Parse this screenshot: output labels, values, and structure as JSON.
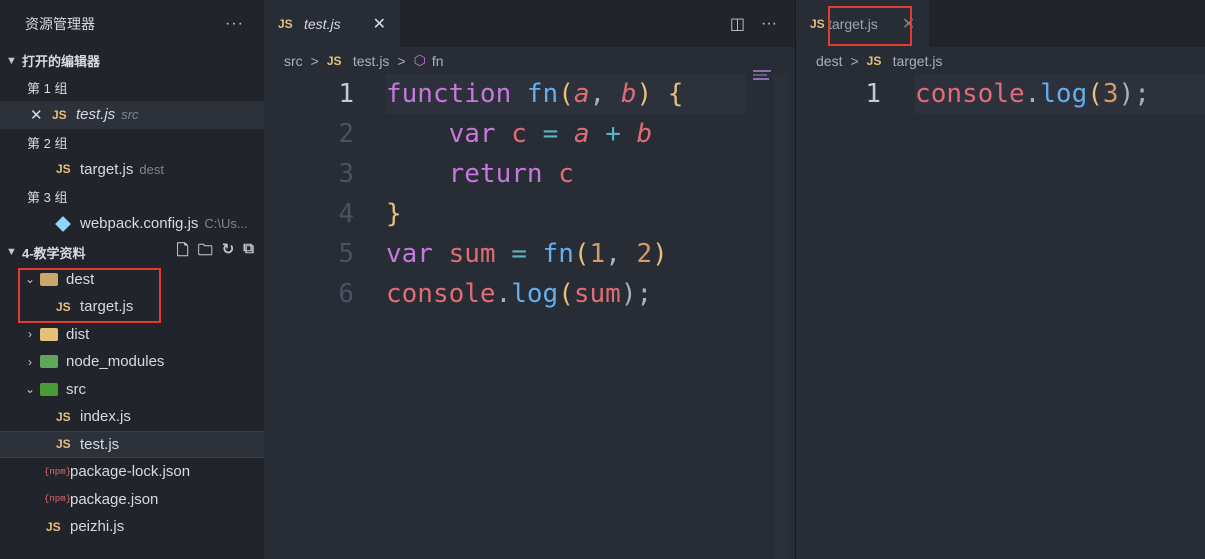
{
  "sidebar": {
    "title": "资源管理器",
    "more": "···",
    "open_editors": {
      "title": "打开的编辑器",
      "groups": [
        {
          "label": "第 1 组",
          "file": "test.js",
          "desc": "src",
          "close": "✕"
        },
        {
          "label": "第 2 组",
          "file": "target.js",
          "desc": "dest"
        },
        {
          "label": "第 3 组",
          "file": "webpack.config.js",
          "desc": "C:\\Us..."
        }
      ]
    },
    "workspace": {
      "title": "4-教学资料",
      "items": [
        {
          "name": "dest",
          "type": "folder",
          "expanded": true
        },
        {
          "name": "target.js",
          "type": "js"
        },
        {
          "name": "dist",
          "type": "folder",
          "expanded": false
        },
        {
          "name": "node_modules",
          "type": "folder",
          "expanded": false
        },
        {
          "name": "src",
          "type": "folder",
          "expanded": true
        },
        {
          "name": "index.js",
          "type": "js"
        },
        {
          "name": "test.js",
          "type": "js"
        },
        {
          "name": "package-lock.json",
          "type": "json"
        },
        {
          "name": "package.json",
          "type": "json"
        },
        {
          "name": "peizhi.js",
          "type": "js"
        }
      ]
    },
    "js_badge": "JS",
    "json_badge": "{npm}"
  },
  "editor1": {
    "tab": {
      "label": "test.js",
      "close": "✕"
    },
    "actions": {
      "split": "◫",
      "more": "···"
    },
    "breadcrumb": {
      "folder": "src",
      "file": "test.js",
      "symbol": "fn",
      "sep": ">"
    },
    "lines": [
      {
        "n": "1",
        "current": true
      },
      {
        "n": "2"
      },
      {
        "n": "3"
      },
      {
        "n": "4"
      },
      {
        "n": "5"
      },
      {
        "n": "6"
      }
    ],
    "tokens": {
      "l1": [
        "function",
        " ",
        "fn",
        "(",
        "a",
        ", ",
        "b",
        ")",
        " ",
        "{"
      ],
      "l2": [
        "    ",
        "var",
        " ",
        "c",
        " ",
        "=",
        " ",
        "a",
        " ",
        "+",
        " ",
        "b"
      ],
      "l3": [
        "    ",
        "return",
        " ",
        "c"
      ],
      "l4": [
        "}"
      ],
      "l5": [
        "var",
        " ",
        "sum",
        " ",
        "=",
        " ",
        "fn",
        "(",
        "1",
        ", ",
        "2",
        ")"
      ],
      "l6": [
        "console",
        ".",
        "log",
        "(",
        "sum",
        ");"
      ]
    }
  },
  "editor2": {
    "tab": {
      "label": "target.js",
      "close": "✕"
    },
    "breadcrumb": {
      "folder": "dest",
      "file": "target.js",
      "sep": ">"
    },
    "line_number": "1",
    "tokens": [
      "console",
      ".",
      "log",
      "(",
      "3",
      ");"
    ]
  },
  "colors": {
    "keyword": "#c678dd",
    "function": "#61afef",
    "variable": "#e06c75",
    "number": "#d19a66",
    "highlight_box": "#e53935"
  }
}
